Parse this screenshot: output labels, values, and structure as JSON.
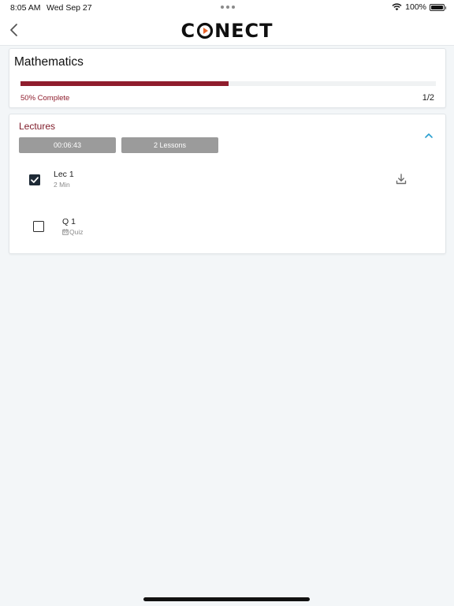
{
  "status_bar": {
    "time": "8:05 AM",
    "date": "Wed Sep 27",
    "battery": "100%"
  },
  "nav": {
    "logo_left": "C",
    "logo_right": "NECT",
    "back_icon": "chevron-left-icon"
  },
  "course": {
    "title": "Mathematics",
    "progress_percent": 50,
    "progress_label": "50% Complete",
    "progress_count": "1/2"
  },
  "lectures": {
    "title": "Lectures",
    "duration": "00:06:43",
    "lessons": "2 Lessons",
    "items": [
      {
        "title": "Lec 1",
        "subtitle": "2 Min",
        "checked": true,
        "icon": "download-icon"
      },
      {
        "title": "Q 1",
        "subtitle": "Quiz",
        "checked": false,
        "icon": "calendar-icon"
      }
    ]
  },
  "colors": {
    "accent": "#8f1d2d",
    "section_title": "#7e1a28",
    "pill": "#9b9b9b",
    "collapse_chevron": "#2a9fd0",
    "logo_play": "#e8632a"
  }
}
